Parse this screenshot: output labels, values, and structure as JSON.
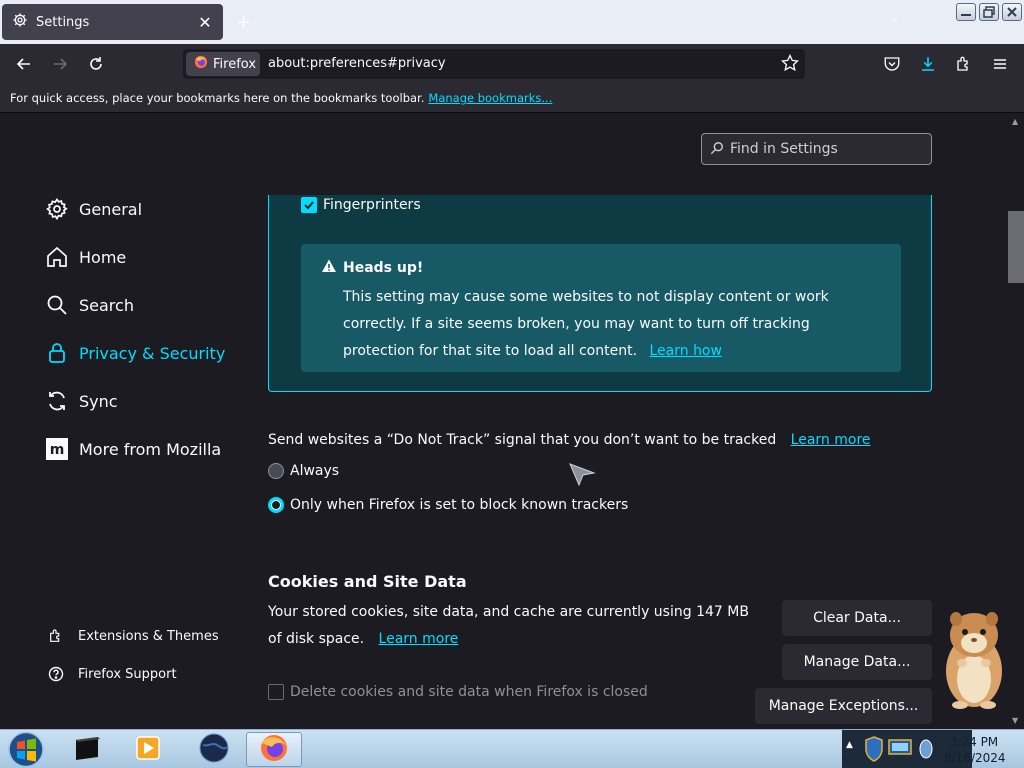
{
  "browser": {
    "tab": {
      "title": "Settings",
      "icon": "gear-icon",
      "close_icon": "close-icon"
    },
    "newtab_icon": "plus-icon",
    "window_controls": [
      "minimize-icon",
      "maximize-icon",
      "close-icon"
    ],
    "nav": {
      "back_icon": "back-arrow-icon",
      "forward_icon": "forward-arrow-icon",
      "reload_icon": "reload-icon",
      "identity_label": "Firefox",
      "url": "about:preferences#privacy",
      "bookmark_icon": "star-icon",
      "toolbar_icons": [
        "pocket-icon",
        "download-icon",
        "extensions-icon",
        "menu-icon"
      ]
    },
    "bookmarks_toolbar": {
      "message": "For quick access, place your bookmarks here on the bookmarks toolbar.",
      "link": "Manage bookmarks..."
    }
  },
  "settings": {
    "search_placeholder": "Find in Settings",
    "categories": [
      {
        "label": "General",
        "icon": "gear-icon",
        "selected": false
      },
      {
        "label": "Home",
        "icon": "home-icon",
        "selected": false
      },
      {
        "label": "Search",
        "icon": "search-icon",
        "selected": false
      },
      {
        "label": "Privacy & Security",
        "icon": "lock-icon",
        "selected": true
      },
      {
        "label": "Sync",
        "icon": "sync-icon",
        "selected": false
      },
      {
        "label": "More from Mozilla",
        "icon": "mozilla-icon",
        "selected": false
      }
    ],
    "footer_links": [
      {
        "label": "Extensions & Themes",
        "icon": "puzzle-icon"
      },
      {
        "label": "Firefox Support",
        "icon": "help-icon"
      }
    ],
    "tracking": {
      "fingerprinters_label": "Fingerprinters",
      "fingerprinters_checked": true,
      "headsup_title": "Heads up!",
      "headsup_text": "This setting may cause some websites to not display content or work correctly. If a site seems broken, you may want to turn off tracking protection for that site to load all content.",
      "headsup_link": "Learn how"
    },
    "dnt": {
      "text": "Send websites a “Do Not Track” signal that you don’t want to be tracked",
      "link": "Learn more",
      "options": [
        {
          "label": "Always",
          "selected": false
        },
        {
          "label": "Only when Firefox is set to block known trackers",
          "selected": true
        }
      ]
    },
    "cookies": {
      "title": "Cookies and Site Data",
      "text": "Your stored cookies, site data, and cache are currently using 147 MB of disk space.",
      "link": "Learn more",
      "clear_button": "Clear Data...",
      "manage_button": "Manage Data...",
      "exceptions_button": "Manage Exceptions...",
      "delete_on_close_label": "Delete cookies and site data when Firefox is closed",
      "delete_on_close_checked": false
    }
  },
  "taskbar": {
    "start_icon": "windows-start-icon",
    "apps": [
      "terminal-icon",
      "media-player-icon",
      "globe-icon",
      "firefox-icon"
    ],
    "clock_time": "3:24 PM",
    "clock_date": "8/16/2024"
  },
  "colors": {
    "accent": "#00ddff",
    "background": "#1c1b22",
    "toolbar": "#2b2a33"
  }
}
